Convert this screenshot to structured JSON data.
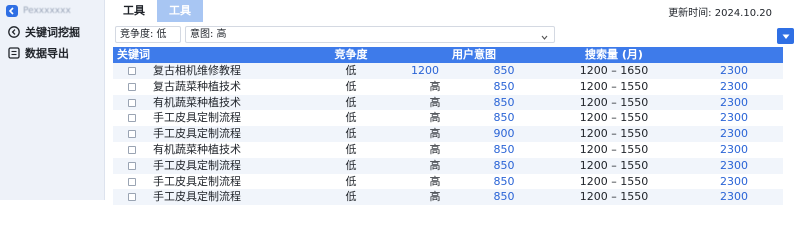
{
  "brand": {
    "name": "Pexxxxxxx"
  },
  "sidebar": {
    "items": [
      {
        "label": "关键词挖掘",
        "icon": "chevron-left-circle-icon"
      },
      {
        "label": "数据导出",
        "icon": "list-icon"
      }
    ]
  },
  "tabs": [
    {
      "label": "工具"
    },
    {
      "label": "工具"
    }
  ],
  "update": {
    "text": "更新时间:  2024.10.20"
  },
  "filters": {
    "competition": "竞争度: 低",
    "intent": "意图: 高"
  },
  "table": {
    "headers": {
      "keyword": "关键词",
      "competition": "竞争度",
      "intent": "用户意图",
      "volume": "搜索量 (月)"
    },
    "rows": [
      {
        "keyword": "复古相机维修教程",
        "competition": "低",
        "intent_a": "1200",
        "intent_b": "850",
        "range": "1200 – 1650",
        "volume": "2300"
      },
      {
        "keyword": "复古蔬菜种植技术",
        "competition": "低",
        "intent_a": "高",
        "intent_b": "850",
        "range": "1200 – 1550",
        "volume": "2300"
      },
      {
        "keyword": "有机蔬菜种植技术",
        "competition": "低",
        "intent_a": "高",
        "intent_b": "850",
        "range": "1200 – 1550",
        "volume": "2300"
      },
      {
        "keyword": "手工皮具定制流程",
        "competition": "低",
        "intent_a": "高",
        "intent_b": "850",
        "range": "1200 – 1550",
        "volume": "2300"
      },
      {
        "keyword": "手工皮具定制流程",
        "competition": "低",
        "intent_a": "高",
        "intent_b": "900",
        "range": "1200 – 1550",
        "volume": "2300"
      },
      {
        "keyword": "有机蔬菜种植技术",
        "competition": "低",
        "intent_a": "高",
        "intent_b": "850",
        "range": "1200 – 1550",
        "volume": "2300"
      },
      {
        "keyword": "手工皮具定制流程",
        "competition": "低",
        "intent_a": "高",
        "intent_b": "850",
        "range": "1200 – 1550",
        "volume": "2300"
      },
      {
        "keyword": "手工皮具定制流程",
        "competition": "低",
        "intent_a": "高",
        "intent_b": "850",
        "range": "1200 – 1550",
        "volume": "2300"
      },
      {
        "keyword": "手工皮具定制流程",
        "competition": "低",
        "intent_a": "高",
        "intent_b": "850",
        "range": "1200 – 1550",
        "volume": "2300"
      }
    ]
  },
  "colors": {
    "accent": "#3e7bea",
    "sidebar_bg": "#eef2f9",
    "link": "#2a64d6",
    "tab_active": "#a8c6f3"
  }
}
